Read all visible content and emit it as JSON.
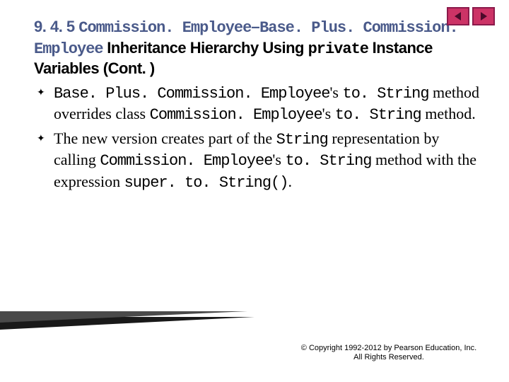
{
  "nav": {
    "prev": "previous-slide",
    "next": "next-slide"
  },
  "heading": {
    "section": "9. 4. 5 ",
    "class1": "Commission. Employee",
    "sep": "–",
    "class2": "Base. Plus. Commission. Employee",
    "rest1": " Inheritance Hierarchy Using ",
    "kw": "private",
    "rest2": " Instance Variables (Cont. )"
  },
  "bullets": [
    {
      "parts": [
        {
          "t": "Base. Plus. Commission. Employee",
          "mono": true
        },
        {
          "t": "'s "
        },
        {
          "t": "to. String",
          "mono": true
        },
        {
          "t": " method overrides class "
        },
        {
          "t": "Commission. Employee",
          "mono": true
        },
        {
          "t": "'s "
        },
        {
          "t": "to. String",
          "mono": true
        },
        {
          "t": " method."
        }
      ]
    },
    {
      "parts": [
        {
          "t": "The new version creates part of the "
        },
        {
          "t": "String",
          "mono": true
        },
        {
          "t": " representation by calling "
        },
        {
          "t": "Commission. Employee",
          "mono": true
        },
        {
          "t": "'s "
        },
        {
          "t": "to. String",
          "mono": true
        },
        {
          "t": " method with the expression "
        },
        {
          "t": "super. to. String()",
          "mono": true
        },
        {
          "t": "."
        }
      ]
    }
  ],
  "copyright": "© Copyright 1992-2012 by Pearson Education, Inc. All Rights Reserved."
}
